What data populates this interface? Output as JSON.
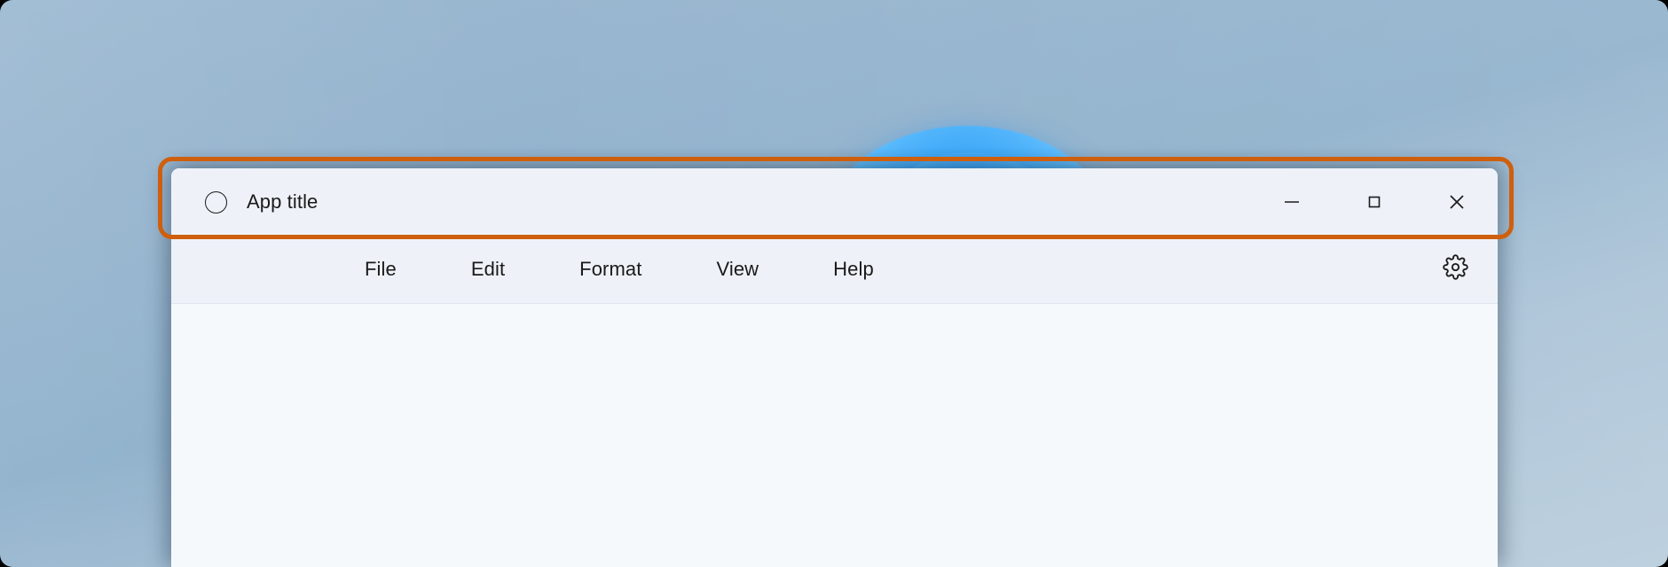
{
  "desktop": {
    "wallpaper_name": "windows-bloom-wallpaper",
    "background_color": "#8eb0cb",
    "bloom_color": "#1e86f0"
  },
  "window": {
    "title_bar": {
      "app_icon": "circle-icon",
      "title": "App title",
      "controls": [
        {
          "name": "minimize",
          "label": "Minimize",
          "glyph": "minimize-icon"
        },
        {
          "name": "maximize",
          "label": "Maximize",
          "glyph": "maximize-icon"
        },
        {
          "name": "close",
          "label": "Close",
          "glyph": "close-icon"
        }
      ]
    },
    "menu_bar": {
      "items": [
        {
          "label": "File"
        },
        {
          "label": "Edit"
        },
        {
          "label": "Format"
        },
        {
          "label": "View"
        },
        {
          "label": "Help"
        }
      ],
      "settings": {
        "icon": "gear-icon",
        "label": "Settings"
      }
    },
    "content": {
      "text": ""
    }
  },
  "annotation": {
    "highlight_color": "#cf5f0d",
    "target": "title-bar",
    "label": ""
  }
}
